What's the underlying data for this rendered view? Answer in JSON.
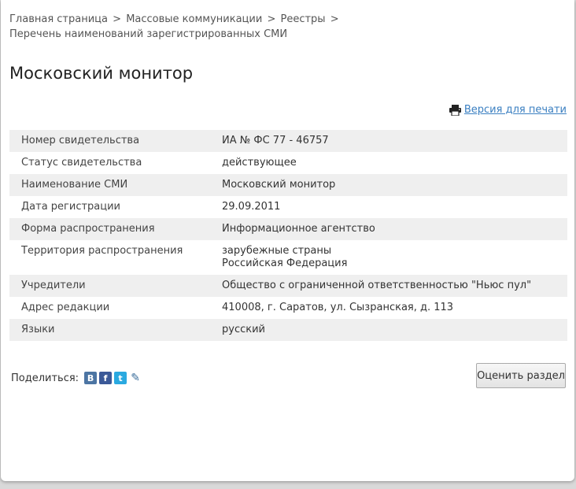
{
  "breadcrumb": {
    "items": [
      "Главная страница",
      "Массовые коммуникации",
      "Реестры",
      "Перечень наименований зарегистрированных СМИ"
    ],
    "separator": ">"
  },
  "page": {
    "title": "Московский монитор",
    "print_label": "Версия для печати"
  },
  "table": {
    "rows": [
      {
        "label": "Номер свидетельства",
        "value": "ИА № ФС 77 - 46757"
      },
      {
        "label": "Статус свидетельства",
        "value": "действующее"
      },
      {
        "label": "Наименование СМИ",
        "value": "Московский монитор"
      },
      {
        "label": "Дата регистрации",
        "value": "29.09.2011"
      },
      {
        "label": "Форма распространения",
        "value": "Информационное агентство"
      },
      {
        "label": "Территория распространения",
        "value": "зарубежные страны",
        "value2": "Российская Федерация"
      },
      {
        "label": "Учредители",
        "value": "Общество с ограниченной ответственностью \"Ньюс пул\""
      },
      {
        "label": "Адрес редакции",
        "value": "410008, г. Саратов, ул. Сызранская, д. 113"
      },
      {
        "label": "Языки",
        "value": "русский"
      }
    ]
  },
  "share": {
    "label": "Поделиться:",
    "icons": [
      {
        "name": "vk-icon",
        "glyph": "В",
        "color": "#4c75a3"
      },
      {
        "name": "facebook-icon",
        "glyph": "f",
        "color": "#3b5998"
      },
      {
        "name": "twitter-icon",
        "glyph": "t",
        "color": "#2aa9e0"
      },
      {
        "name": "livejournal-icon",
        "glyph": "✎",
        "color": "#5b8fb9"
      }
    ]
  },
  "rate_button": "Оценить раздел",
  "colors": {
    "link": "#3a7fc1",
    "stripe": "#efefef"
  }
}
